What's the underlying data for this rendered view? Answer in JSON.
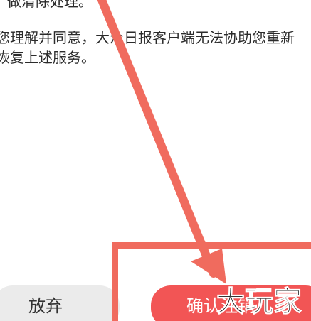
{
  "content": {
    "line1": "，做清除处理。",
    "line2": "您理解并同意，大众日报客户端无法协助您重新",
    "line3": "恢复上述服务。"
  },
  "buttons": {
    "abandon_label": "放弃",
    "confirm_label": "确认注销"
  },
  "watermark": {
    "text": "大玩家"
  },
  "colors": {
    "confirm_bg": "#f25555",
    "abandon_bg": "#ebebeb",
    "annotation": "#f06b5e"
  },
  "icons": {
    "annotation_arrow": "arrow-down-right-icon"
  }
}
